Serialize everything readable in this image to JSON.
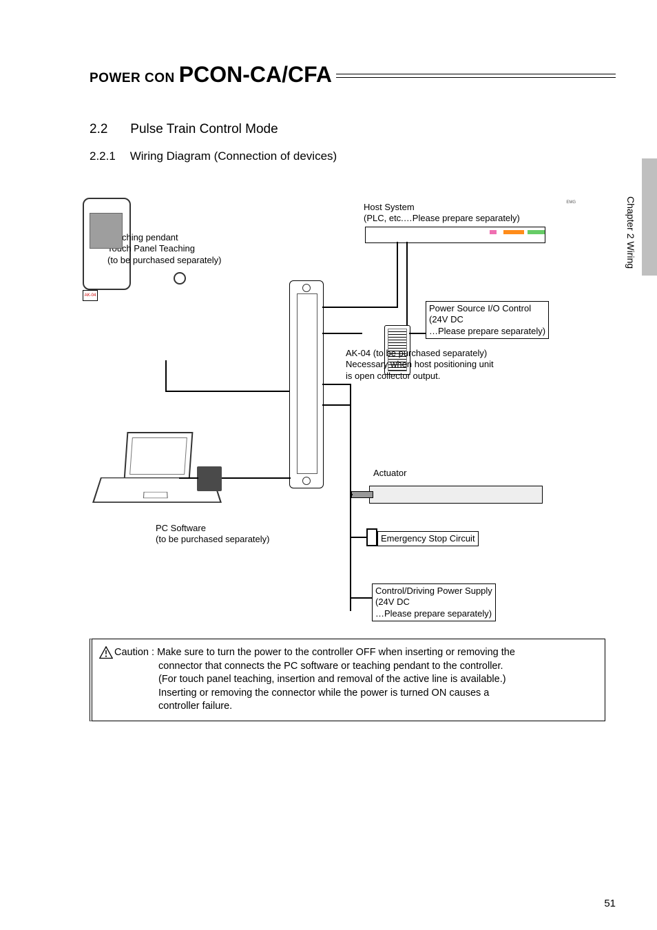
{
  "header": {
    "prefix": "POWER CON",
    "model": "PCON-CA/CFA"
  },
  "section": {
    "num": "2.2",
    "title": "Pulse Train Control Mode"
  },
  "subsection": {
    "num": "2.2.1",
    "title": "Wiring Diagram (Connection of devices)"
  },
  "side_tab": "Chapter 2  Wiring",
  "labels": {
    "host1": "Host System",
    "host2": "(PLC, etc.…Please prepare separately)",
    "pendant1": "Teaching pendant",
    "pendant2": "Touch Panel Teaching",
    "pendant3": "(to be purchased separately)",
    "io1": "Power Source I/O Control",
    "io2": "(24V DC",
    "io3": "…Please prepare separately)",
    "ak04_tag": "AK-04",
    "ak04_1": "AK-04 (to be purchased separately)",
    "ak04_2": "Necessary when host positioning unit",
    "ak04_3": "is open collector output.",
    "actuator": "Actuator",
    "pcsw1": "PC Software",
    "pcsw2": "(to be purchased separately)",
    "estop": "Emergency Stop Circuit",
    "psu1": "Control/Driving Power Supply",
    "psu2": "(24V DC",
    "psu3": "…Please prepare separately)"
  },
  "caution": {
    "lead": "Caution :",
    "l1": "Make sure to turn the power to the controller OFF when inserting or removing the",
    "l2": "connector that connects the PC software or teaching pendant to the controller.",
    "l3": "(For touch panel teaching, insertion and removal of the active line is available.)",
    "l4": "Inserting or removing the connector while the power is turned ON causes a",
    "l5": "controller failure."
  },
  "page_number": "51"
}
